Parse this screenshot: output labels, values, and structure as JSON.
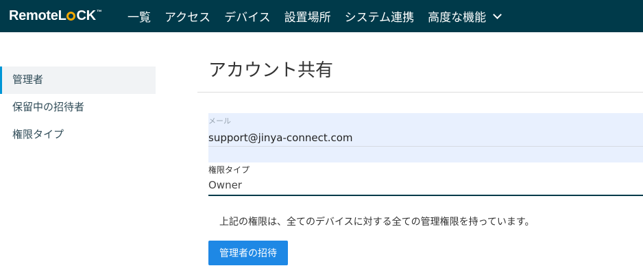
{
  "brand": {
    "logo_left": "Remote",
    "logo_l": "L",
    "logo_ck": "CK",
    "logo_tm": "™",
    "accent_color": "#f5a800"
  },
  "nav": {
    "items": [
      "一覧",
      "アクセス",
      "デバイス",
      "設置場所",
      "システム連携",
      "高度な機能"
    ],
    "bg_color": "#003a4a"
  },
  "sidebar": {
    "items": [
      {
        "label": "管理者",
        "active": true
      },
      {
        "label": "保留中の招待者",
        "active": false
      },
      {
        "label": "権限タイプ",
        "active": false
      }
    ]
  },
  "main": {
    "title": "アカウント共有",
    "email": {
      "label": "メール",
      "value": "support@jinya-connect.com"
    },
    "permission": {
      "label": "権限タイプ",
      "selected": "Owner"
    },
    "note": "上記の権限は、全てのデバイスに対する全ての管理権限を持っています。",
    "invite_button": "管理者の招待",
    "button_color": "#1e88e5"
  }
}
